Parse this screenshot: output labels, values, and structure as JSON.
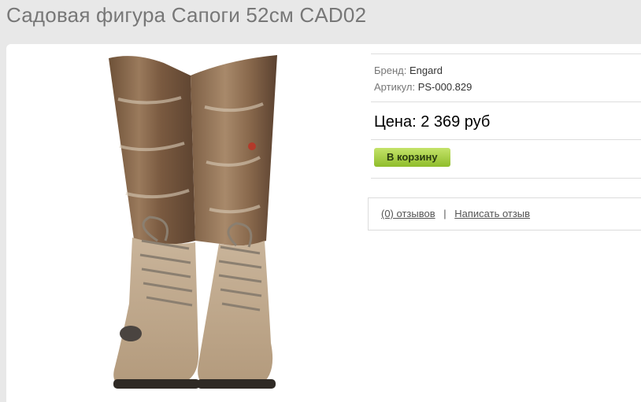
{
  "page": {
    "title": "Садовая фигура Сапоги 52см CAD02"
  },
  "product": {
    "image_alt": "boots-figure",
    "brand_label": "Бренд:",
    "brand_value": "Engard",
    "sku_label": "Артикул:",
    "sku_value": "PS-000.829",
    "price_text": "Цена: 2 369 руб",
    "cart_button_label": "В корзину"
  },
  "reviews": {
    "count_link": "(0) отзывов",
    "separator": "|",
    "write_link": "Написать отзыв"
  },
  "colors": {
    "button_green": "#a6cf3f",
    "title_gray": "#777777"
  }
}
